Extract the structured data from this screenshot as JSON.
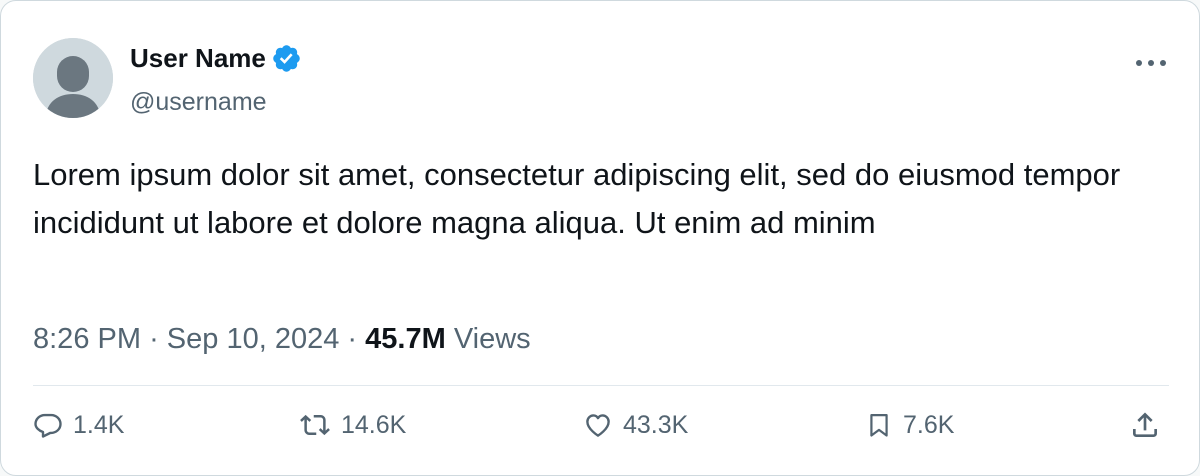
{
  "author": {
    "display_name": "User Name",
    "handle": "@username",
    "verified": true
  },
  "tweet": {
    "text": "Lorem ipsum dolor sit amet, consectetur adipiscing elit, sed do eiusmod tempor incididunt ut labore et dolore magna aliqua. Ut enim ad minim"
  },
  "meta": {
    "time": "8:26 PM",
    "separator": "·",
    "date": "Sep 10, 2024",
    "views_count": "45.7M",
    "views_label": "Views"
  },
  "actions": {
    "replies": "1.4K",
    "retweets": "14.6K",
    "likes": "43.3K",
    "bookmarks": "7.6K"
  },
  "icons": {
    "more": "more-horizontal-icon",
    "reply": "reply-icon",
    "retweet": "retweet-icon",
    "like": "heart-icon",
    "bookmark": "bookmark-icon",
    "share": "share-icon",
    "verified": "verified-badge-icon"
  },
  "colors": {
    "verified_blue": "#1d9bf0",
    "text_primary": "#0f1419",
    "text_secondary": "#536471",
    "avatar_bg": "#cfd9de",
    "avatar_fg": "#6b7780"
  }
}
